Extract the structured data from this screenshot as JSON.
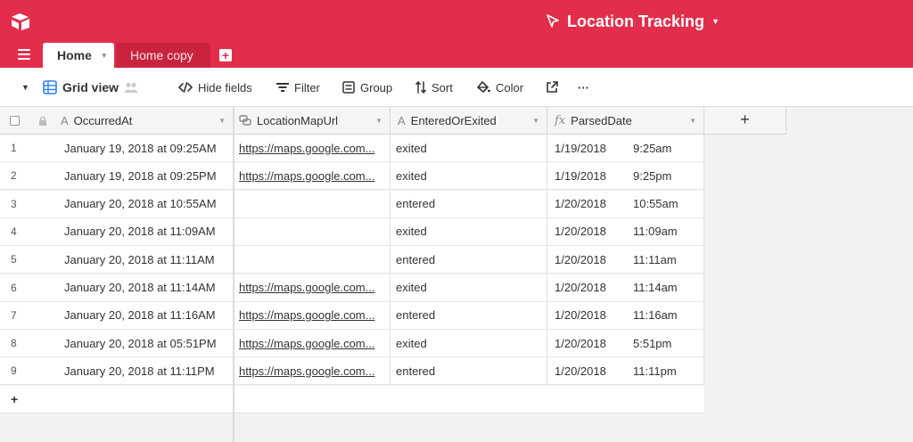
{
  "app": {
    "base_name": "Location Tracking"
  },
  "tabs": {
    "home": "Home",
    "home_copy": "Home copy"
  },
  "viewbar": {
    "view_name": "Grid view",
    "hide_fields": "Hide fields",
    "filter": "Filter",
    "group": "Group",
    "sort": "Sort",
    "color": "Color",
    "more": "···"
  },
  "columns": {
    "occurred_at": "OccurredAt",
    "location_map_url": "LocationMapUrl",
    "entered_or_exited": "EnteredOrExited",
    "parsed_date": "ParsedDate"
  },
  "rows": [
    {
      "num": "1",
      "occurred": "January 19, 2018 at 09:25AM",
      "url": "https://maps.google.com...",
      "status": "exited",
      "date": "1/19/2018",
      "time": "9:25am"
    },
    {
      "num": "2",
      "occurred": "January 19, 2018 at 09:25PM",
      "url": "https://maps.google.com...",
      "status": "exited",
      "date": "1/19/2018",
      "time": "9:25pm"
    },
    {
      "num": "3",
      "occurred": "January 20, 2018 at 10:55AM",
      "url": "",
      "status": "entered",
      "date": "1/20/2018",
      "time": "10:55am"
    },
    {
      "num": "4",
      "occurred": "January 20, 2018 at 11:09AM",
      "url": "",
      "status": "exited",
      "date": "1/20/2018",
      "time": "11:09am"
    },
    {
      "num": "5",
      "occurred": "January 20, 2018 at 11:11AM",
      "url": "",
      "status": "entered",
      "date": "1/20/2018",
      "time": "11:11am"
    },
    {
      "num": "6",
      "occurred": "January 20, 2018 at 11:14AM",
      "url": "https://maps.google.com...",
      "status": "exited",
      "date": "1/20/2018",
      "time": "11:14am"
    },
    {
      "num": "7",
      "occurred": "January 20, 2018 at 11:16AM",
      "url": "https://maps.google.com...",
      "status": "entered",
      "date": "1/20/2018",
      "time": "11:16am"
    },
    {
      "num": "8",
      "occurred": "January 20, 2018 at 05:51PM",
      "url": "https://maps.google.com...",
      "status": "exited",
      "date": "1/20/2018",
      "time": "5:51pm"
    },
    {
      "num": "9",
      "occurred": "January 20, 2018 at 11:11PM",
      "url": "https://maps.google.com...",
      "status": "entered",
      "date": "1/20/2018",
      "time": "11:11pm"
    }
  ],
  "grid": {
    "add_row": "+",
    "add_column": "+"
  },
  "colors": {
    "brand": "#e22e4c",
    "tab_inactive": "#c92340",
    "view_icon": "#2d7ff9"
  }
}
